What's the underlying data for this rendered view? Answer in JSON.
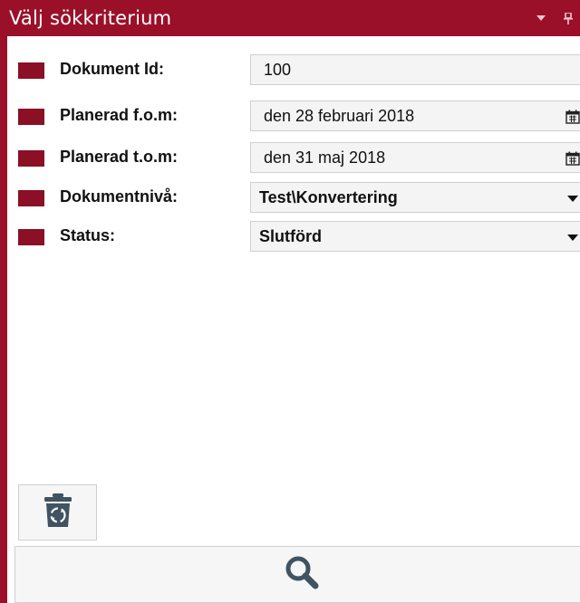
{
  "panel": {
    "title": "Välj sökkriterium",
    "actions": [
      "dropdown-arrow-icon",
      "pin-icon"
    ]
  },
  "criteria": [
    {
      "label": "Dokument Id:",
      "value": "100",
      "kind": "text"
    },
    {
      "label": "Planerad f.o.m:",
      "value": "den 28 februari 2018",
      "kind": "date"
    },
    {
      "label": "Planerad t.o.m:",
      "value": "den 31 maj 2018",
      "kind": "date"
    },
    {
      "label": "Dokumentnivå:",
      "value": "Test\\Konvertering",
      "kind": "select"
    },
    {
      "label": "Status:",
      "value": "Slutförd",
      "kind": "select"
    }
  ],
  "buttons": {
    "trash": "recycle-bin-icon",
    "search": "search-icon"
  },
  "colors": {
    "accent": "#9b1029",
    "marker": "#8b0f25",
    "icon": "#3f5363"
  }
}
